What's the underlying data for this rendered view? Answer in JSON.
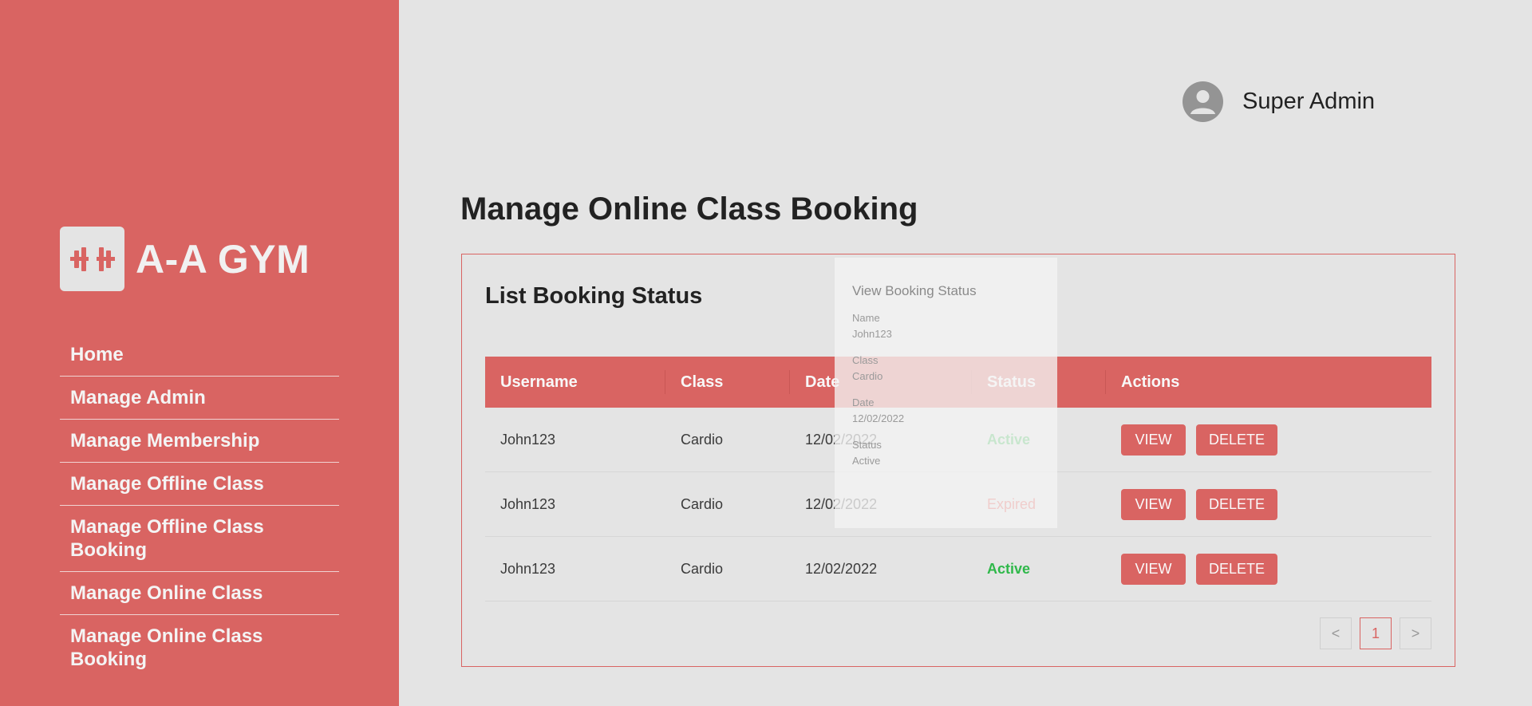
{
  "brand": {
    "name": "A-A GYM",
    "logo_icon": "dumbbell-icon"
  },
  "nav": {
    "items": [
      {
        "label": "Home"
      },
      {
        "label": "Manage Admin"
      },
      {
        "label": "Manage Membership"
      },
      {
        "label": "Manage Offline Class"
      },
      {
        "label": "Manage Offline Class Booking"
      },
      {
        "label": "Manage Online Class"
      },
      {
        "label": "Manage Online Class Booking"
      }
    ]
  },
  "header": {
    "user_name": "Super Admin",
    "avatar_icon": "user-avatar-icon"
  },
  "page": {
    "title": "Manage Online Class Booking"
  },
  "card": {
    "title": "List Booking Status",
    "columns": [
      "Username",
      "Class",
      "Date",
      "Status",
      "Actions"
    ],
    "rows": [
      {
        "username": "John123",
        "class": "Cardio",
        "date": "12/02/2022",
        "status": "Active"
      },
      {
        "username": "John123",
        "class": "Cardio",
        "date": "12/02/2022",
        "status": "Expired"
      },
      {
        "username": "John123",
        "class": "Cardio",
        "date": "12/02/2022",
        "status": "Active"
      }
    ],
    "view_label": "VIEW",
    "delete_label": "DELETE"
  },
  "pagination": {
    "prev": "<",
    "current": "1",
    "next": ">"
  },
  "overlay": {
    "title": "View Booking Status",
    "fields": [
      {
        "label": "Name",
        "value": "John123"
      },
      {
        "label": "Class",
        "value": "Cardio"
      },
      {
        "label": "Date",
        "value": "12/02/2022"
      },
      {
        "label": "Status",
        "value": "Active"
      }
    ]
  },
  "colors": {
    "primary": "#d96462",
    "background": "#e4e4e4",
    "active": "#2fb84a",
    "expired": "#e2453f"
  }
}
